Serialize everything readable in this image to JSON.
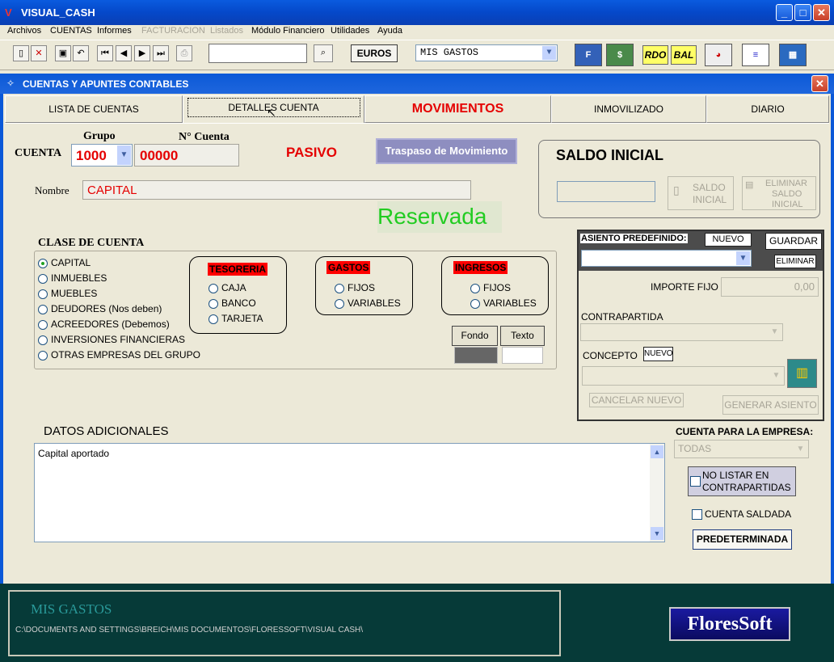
{
  "app": {
    "title": "VISUAL_CASH",
    "icon": "V"
  },
  "menu": [
    "Archivos",
    "CUENTAS",
    "Informes",
    "FACTURACION",
    "Listados",
    "Módulo Financiero",
    "Utilidades",
    "Ayuda"
  ],
  "toolbar": {
    "search_value": "",
    "euros_label": "EUROS",
    "company_combo": "MIS GASTOS",
    "rdo_label": "RDO",
    "bal_label": "BAL"
  },
  "window": {
    "title": "CUENTAS Y APUNTES CONTABLES"
  },
  "tabs": [
    "LISTA DE CUENTAS",
    "DETALLES CUENTA",
    "MOVIMIENTOS",
    "INMOVILIZADO",
    "DIARIO"
  ],
  "account": {
    "cuenta_label": "CUENTA",
    "grupo_label": "Grupo",
    "numero_label": "N° Cuenta",
    "grupo_value": "1000",
    "numero_value": "00000",
    "tipo": "PASIVO",
    "traspaso_label": "Traspaso de Movimiento",
    "nombre_label": "Nombre",
    "nombre_value": "CAPITAL",
    "reservada": "Reservada"
  },
  "saldo": {
    "title": "SALDO INICIAL",
    "value": "",
    "saldo_btn_1": "SALDO",
    "saldo_btn_2": "INICIAL",
    "eliminar_1": "ELIMINAR",
    "eliminar_2": "SALDO",
    "eliminar_3": "INICIAL"
  },
  "clase": {
    "title": "CLASE DE CUENTA",
    "options": [
      "CAPITAL",
      "INMUEBLES",
      "MUEBLES",
      "DEUDORES (Nos deben)",
      "ACREEDORES (Debemos)",
      "INVERSIONES FINANCIERAS",
      "OTRAS EMPRESAS DEL GRUPO"
    ],
    "selected": "CAPITAL",
    "tesoreria": {
      "title": "TESORERIA",
      "options": [
        "CAJA",
        "BANCO",
        "TARJETA"
      ]
    },
    "gastos": {
      "title": "GASTOS",
      "options": [
        "FIJOS",
        "VARIABLES"
      ]
    },
    "ingresos": {
      "title": "INGRESOS",
      "options": [
        "FIJOS",
        "VARIABLES"
      ]
    },
    "fondo_label": "Fondo",
    "texto_label": "Texto",
    "fondo_color": "#666666",
    "texto_color": "#ffffff"
  },
  "asiento": {
    "title": "ASIENTO PREDEFINIDO:",
    "nuevo_label": "NUEVO",
    "guardar_label": "GUARDAR",
    "eliminar_label": "ELIMINAR",
    "importe_label": "IMPORTE FIJO",
    "importe_value": "0,00",
    "contrapartida_label": "CONTRAPARTIDA",
    "concepto_label": "CONCEPTO",
    "concepto_nuevo": "NUEVO",
    "cancelar_label": "CANCELAR NUEVO",
    "generar_label": "GENERAR ASIENTO"
  },
  "datos": {
    "title": "DATOS ADICIONALES",
    "text": "Capital aportado"
  },
  "empresa": {
    "label": "CUENTA PARA LA EMPRESA:",
    "value": "TODAS",
    "no_listar_1": "NO LISTAR EN",
    "no_listar_2": "CONTRAPARTIDAS",
    "saldada_label": "CUENTA SALDADA",
    "predeterminada_label": "PREDETERMINADA"
  },
  "status": {
    "company": "MIS GASTOS",
    "path": "C:\\DOCUMENTS AND SETTINGS\\BREICH\\MIS DOCUMENTOS\\FLORESSOFT\\VISUAL CASH\\",
    "logo": "FloresSoft"
  }
}
